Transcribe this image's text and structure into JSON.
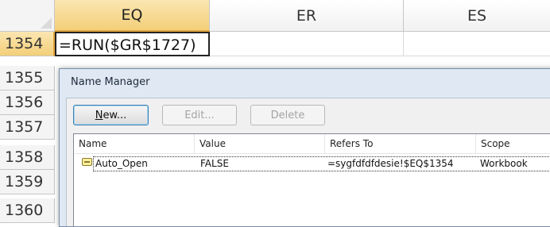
{
  "sheet": {
    "columns": [
      {
        "label": "EQ",
        "selected": true
      },
      {
        "label": "ER",
        "selected": false
      },
      {
        "label": "ES",
        "selected": false
      }
    ],
    "rows": [
      "1354",
      "1355",
      "1356",
      "1357",
      "1358",
      "1359",
      "1360"
    ],
    "selected_row": "1354",
    "active_cell_formula": "=RUN($GR$1727)"
  },
  "dialog": {
    "title": "Name Manager",
    "buttons": {
      "new_label_prefix": "N",
      "new_label_rest": "ew...",
      "edit_label": "Edit...",
      "delete_label": "Delete"
    },
    "list": {
      "headers": {
        "name": "Name",
        "value": "Value",
        "refers_to": "Refers To",
        "scope": "Scope"
      },
      "rows": [
        {
          "icon": "defined-name-icon",
          "name": "Auto_Open",
          "value": "FALSE",
          "refers_to": "=sygfdfdfdesie!$EQ$1354",
          "scope": "Workbook"
        }
      ]
    }
  },
  "colors": {
    "selected_header": "#f3cf78",
    "dialog_frame": "#dfe8f3"
  }
}
